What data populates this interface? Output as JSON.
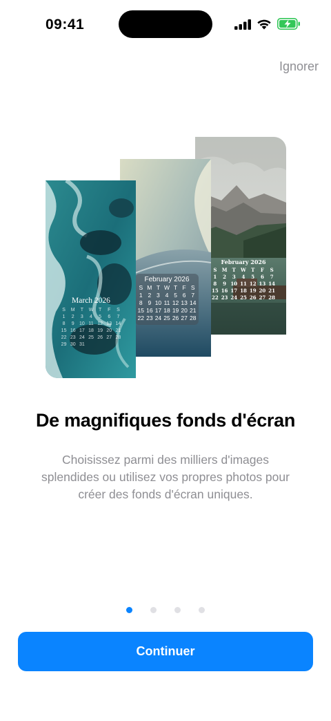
{
  "status_bar": {
    "time": "09:41",
    "icons": [
      "cellular-signal-icon",
      "wifi-icon",
      "battery-charging-icon"
    ],
    "battery_color": "#34c759"
  },
  "header": {
    "skip_label": "Ignorer"
  },
  "wallpapers": [
    {
      "style": "ocean",
      "calendar_title": "March 2026",
      "weekdays": [
        "S",
        "M",
        "T",
        "W",
        "T",
        "F",
        "S"
      ],
      "days": [
        "1",
        "2",
        "3",
        "4",
        "5",
        "6",
        "7",
        "8",
        "9",
        "10",
        "11",
        "12",
        "13",
        "14",
        "15",
        "16",
        "17",
        "18",
        "19",
        "20",
        "21",
        "22",
        "23",
        "24",
        "25",
        "26",
        "27",
        "28",
        "29",
        "30",
        "31"
      ]
    },
    {
      "style": "abstract",
      "calendar_title": "February 2026",
      "weekdays": [
        "S",
        "M",
        "T",
        "W",
        "T",
        "F",
        "S"
      ],
      "days": [
        "1",
        "2",
        "3",
        "4",
        "5",
        "6",
        "7",
        "8",
        "9",
        "10",
        "11",
        "12",
        "13",
        "14",
        "15",
        "16",
        "17",
        "18",
        "19",
        "20",
        "21",
        "22",
        "23",
        "24",
        "25",
        "26",
        "27",
        "28"
      ]
    },
    {
      "style": "mountain",
      "calendar_title": "February 2026",
      "weekdays": [
        "S",
        "M",
        "T",
        "W",
        "T",
        "F",
        "S"
      ],
      "days": [
        "1",
        "2",
        "3",
        "4",
        "5",
        "6",
        "7",
        "8",
        "9",
        "10",
        "11",
        "12",
        "13",
        "14",
        "15",
        "16",
        "17",
        "18",
        "19",
        "20",
        "21",
        "22",
        "23",
        "24",
        "25",
        "26",
        "27",
        "28"
      ]
    }
  ],
  "content": {
    "headline": "De magnifiques fonds d'écran",
    "subtitle": "Choisissez parmi des milliers d'images splendides ou utilisez vos propres photos pour créer des fonds d'écran uniques."
  },
  "pagination": {
    "count": 4,
    "active": 0,
    "active_color": "#0a84ff"
  },
  "footer": {
    "continue_label": "Continuer",
    "accent": "#0a84ff"
  }
}
